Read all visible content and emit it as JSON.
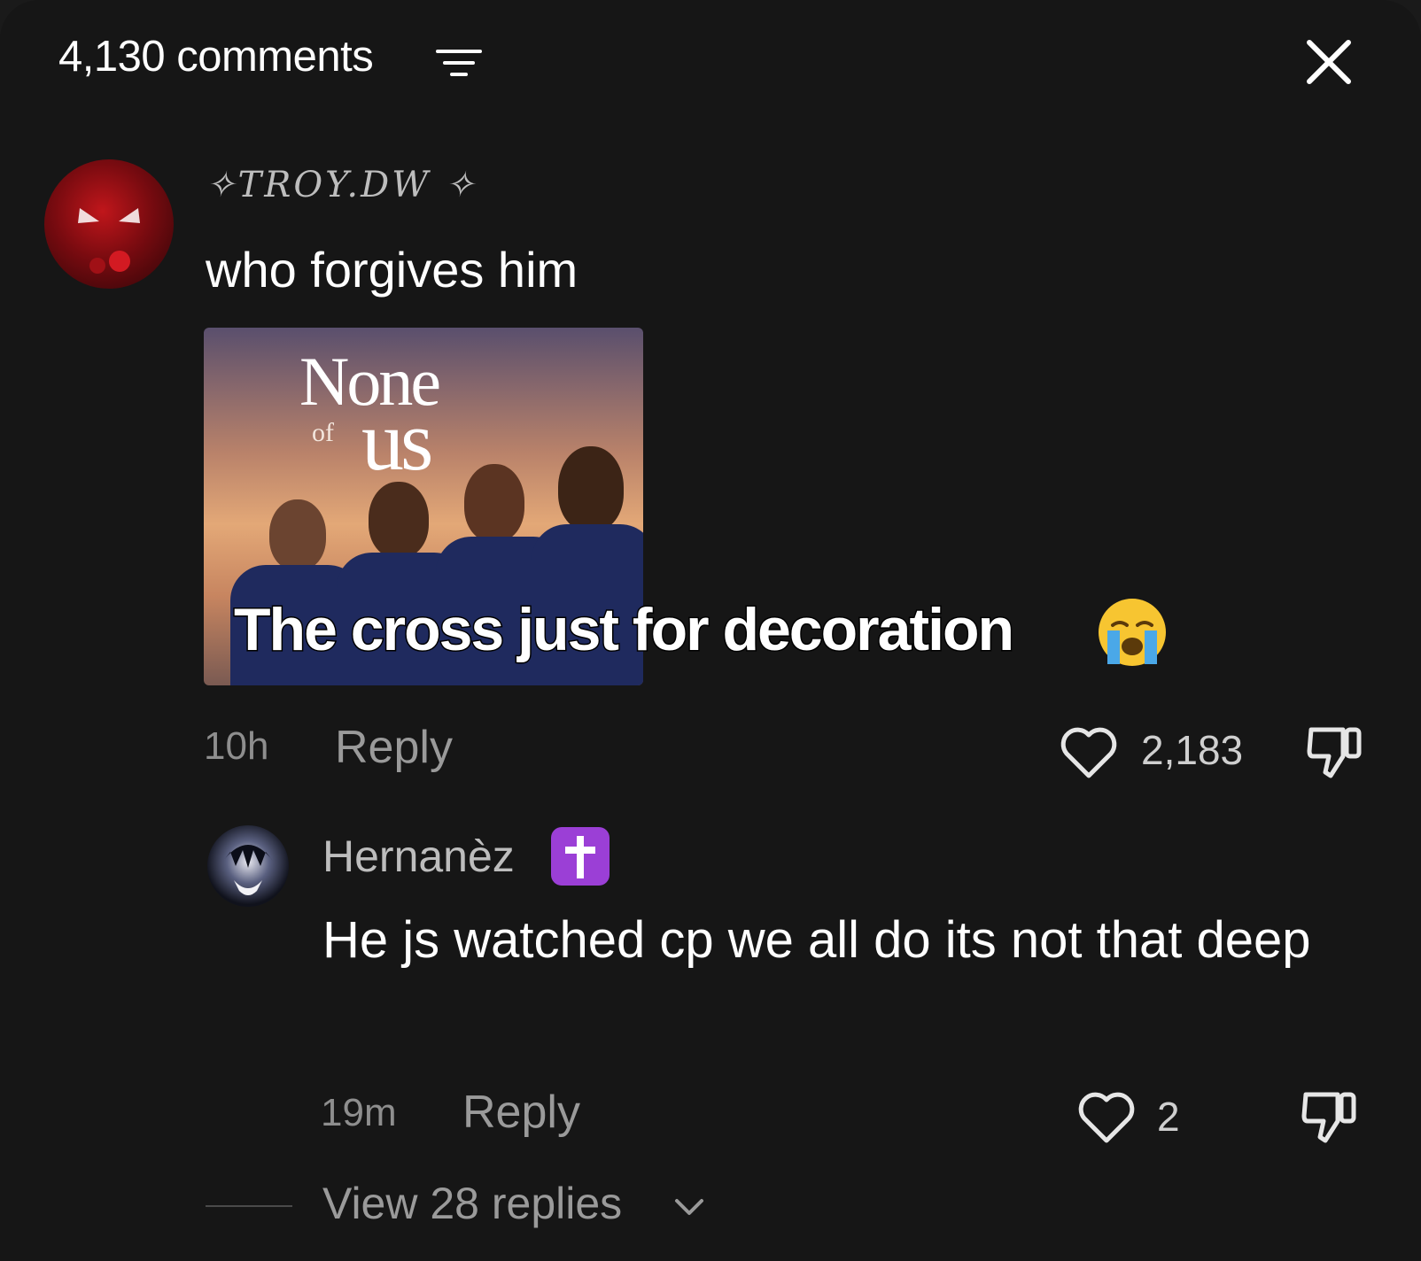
{
  "header": {
    "comment_count": "4,130 comments"
  },
  "comments": [
    {
      "username": "✧TROY.DW ✧",
      "text": "who forgives him",
      "image_overlay": {
        "title_line1": "None",
        "title_of": "of",
        "title_line2": "us"
      },
      "caption": "The cross just for decoration",
      "time": "10h",
      "reply_label": "Reply",
      "likes": "2,183"
    },
    {
      "username": "Hernanèz",
      "text": "He js watched cp we all do its not that deep",
      "time": "19m",
      "reply_label": "Reply",
      "likes": "2"
    }
  ],
  "view_replies": "View 28 replies",
  "colors": {
    "background": "#161616",
    "text_primary": "#ffffff",
    "text_secondary": "#9a9a9a",
    "badge_purple": "#9b3fd6"
  }
}
